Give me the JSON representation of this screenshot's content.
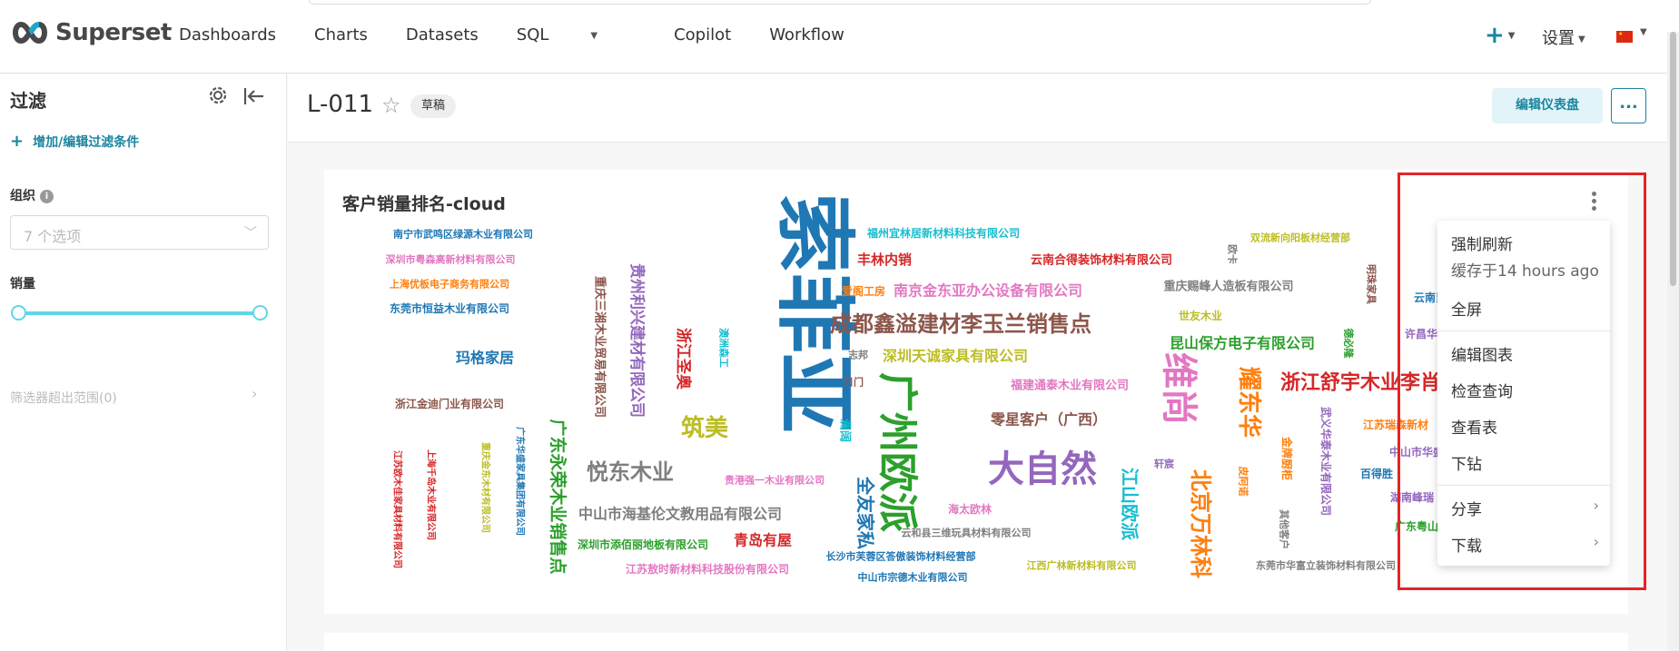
{
  "nav": {
    "brand": "Superset",
    "menu": [
      "Dashboards",
      "Charts",
      "Datasets",
      "SQL",
      "Copilot",
      "Workflow"
    ],
    "plus": "+",
    "settings": "设置"
  },
  "sidebar": {
    "title": "过滤",
    "add_filter": "增加/编辑过滤条件",
    "org_label": "组织",
    "org_placeholder": "7 个选项",
    "sales_label": "销量",
    "out_of_range": "筛选器超出范围(0)"
  },
  "header": {
    "title": "L-011",
    "badge": "草稿",
    "edit_button": "编辑仪表盘",
    "more": "..."
  },
  "chart": {
    "title": "客户销量排名-cloud"
  },
  "menu": {
    "force_refresh": "强制刷新",
    "cached": "缓存于14 hours ago",
    "fullscreen": "全屏",
    "edit_chart": "编辑图表",
    "view_query": "检查查询",
    "view_table": "查看表",
    "drill": "下钻",
    "share": "分享",
    "download": "下载"
  },
  "words": [
    {
      "t": "索菲亚",
      "c": "#1f77b4"
    },
    {
      "t": "广州欧派",
      "c": "#2ca02c"
    },
    {
      "t": "大自然",
      "c": "#9467bd"
    },
    {
      "t": "维尚",
      "c": "#e377c2"
    },
    {
      "t": "成都鑫溢建材李玉兰销售点",
      "c": "#8c564b"
    },
    {
      "t": "浙江舒宇木业李肖",
      "c": "#d62728"
    },
    {
      "t": "耀东华",
      "c": "#ff7f0e"
    },
    {
      "t": "悦东木业",
      "c": "#7f7f7f"
    },
    {
      "t": "筑美",
      "c": "#bcbd22"
    },
    {
      "t": "北京万林科",
      "c": "#ff7f0e"
    },
    {
      "t": "江山欧派",
      "c": "#17becf"
    },
    {
      "t": "全友家私",
      "c": "#1f77b4"
    },
    {
      "t": "南京金东亚办公设备有限公司",
      "c": "#e377c2"
    },
    {
      "t": "零星客户（广西）",
      "c": "#8c564b"
    },
    {
      "t": "深圳天诚家具有限公司",
      "c": "#bcbd22"
    },
    {
      "t": "中山市海基伦文教用品有限公司",
      "c": "#7f7f7f"
    },
    {
      "t": "玛格家居",
      "c": "#1f77b4"
    },
    {
      "t": "广东永荣木业销售点",
      "c": "#2ca02c"
    },
    {
      "t": "青岛有屋",
      "c": "#d62728"
    },
    {
      "t": "丰林内销",
      "c": "#d62728"
    },
    {
      "t": "昆山保方电子有限公司",
      "c": "#2ca02c"
    },
    {
      "t": "浙江圣奥",
      "c": "#d62728"
    },
    {
      "t": "贵州利兴建材有限公司",
      "c": "#9467bd"
    },
    {
      "t": "重庆三湘木业贸易有限公司",
      "c": "#8c564b"
    },
    {
      "t": "云南合得装饰材料有限公司",
      "c": "#d62728"
    },
    {
      "t": "福州宜林居新材料科技有限公司",
      "c": "#17becf"
    },
    {
      "t": "重庆赐峰人造板有限公司",
      "c": "#7f7f7f"
    },
    {
      "t": "福建通泰木业有限公司",
      "c": "#e377c2"
    },
    {
      "t": "南宁市武鸣区绿源木业有限公司",
      "c": "#1f77b4"
    },
    {
      "t": "深圳市粤森高新材料有限公司",
      "c": "#e377c2"
    },
    {
      "t": "上海优板电子商务有限公司",
      "c": "#ff7f0e"
    },
    {
      "t": "东莞市恒益木业有限公司",
      "c": "#1f77b4"
    },
    {
      "t": "浙江金迪门业有限公司",
      "c": "#8c564b"
    },
    {
      "t": "深圳市添佰丽地板有限公司",
      "c": "#2ca02c"
    },
    {
      "t": "江苏敖时新材料科技股份有限公司",
      "c": "#e377c2"
    },
    {
      "t": "贵港强一木业有限公司",
      "c": "#e377c2"
    },
    {
      "t": "长沙市芙蓉区答傲装饰材料经营部",
      "c": "#1f77b4"
    },
    {
      "t": "中山市宗德木业有限公司",
      "c": "#1f77b4"
    },
    {
      "t": "云和县三维玩具材料有限公司",
      "c": "#7f7f7f"
    },
    {
      "t": "江西广林新材料有限公司",
      "c": "#bcbd22"
    },
    {
      "t": "东莞市华富立装饰材料有限公司",
      "c": "#7f7f7f"
    },
    {
      "t": "海太欧林",
      "c": "#e377c2"
    },
    {
      "t": "双流新向阳板材经营部",
      "c": "#bcbd22"
    },
    {
      "t": "世友木业",
      "c": "#bcbd22"
    },
    {
      "t": "爱阁工房",
      "c": "#ff7f0e"
    },
    {
      "t": "澜阔",
      "c": "#17becf"
    },
    {
      "t": "志邦",
      "c": "#7f7f7f"
    },
    {
      "t": "日门",
      "c": "#8c564b"
    },
    {
      "t": "轩宸",
      "c": "#9467bd"
    },
    {
      "t": "澳洲森工",
      "c": "#17becf"
    },
    {
      "t": "江苏瑞森新材",
      "c": "#ff7f0e"
    },
    {
      "t": "中山市华盛",
      "c": "#9467bd"
    },
    {
      "t": "百得胜",
      "c": "#1f77b4"
    },
    {
      "t": "湖南峰瑞",
      "c": "#9467bd"
    },
    {
      "t": "广东粤山新",
      "c": "#2ca02c"
    },
    {
      "t": "许昌华木装",
      "c": "#9467bd"
    },
    {
      "t": "云南昆",
      "c": "#1f77b4"
    },
    {
      "t": "明珠家具",
      "c": "#8c564b"
    },
    {
      "t": "德必隆",
      "c": "#2ca02c"
    },
    {
      "t": "武义华泰木业有限公司",
      "c": "#9467bd"
    },
    {
      "t": "金牌厨柜",
      "c": "#ff7f0e"
    },
    {
      "t": "皮阿诺",
      "c": "#ff7f0e"
    },
    {
      "t": "其他客户",
      "c": "#7f7f7f"
    },
    {
      "t": "欧卡",
      "c": "#7f7f7f"
    },
    {
      "t": "江苏欧木佳家具材料有限公司",
      "c": "#d62728"
    },
    {
      "t": "上海千岛木业有限公司",
      "c": "#d62728"
    },
    {
      "t": "重庆金东木材有限公司",
      "c": "#bcbd22"
    },
    {
      "t": "广东华盛家具集团有限公司",
      "c": "#1f77b4"
    }
  ]
}
